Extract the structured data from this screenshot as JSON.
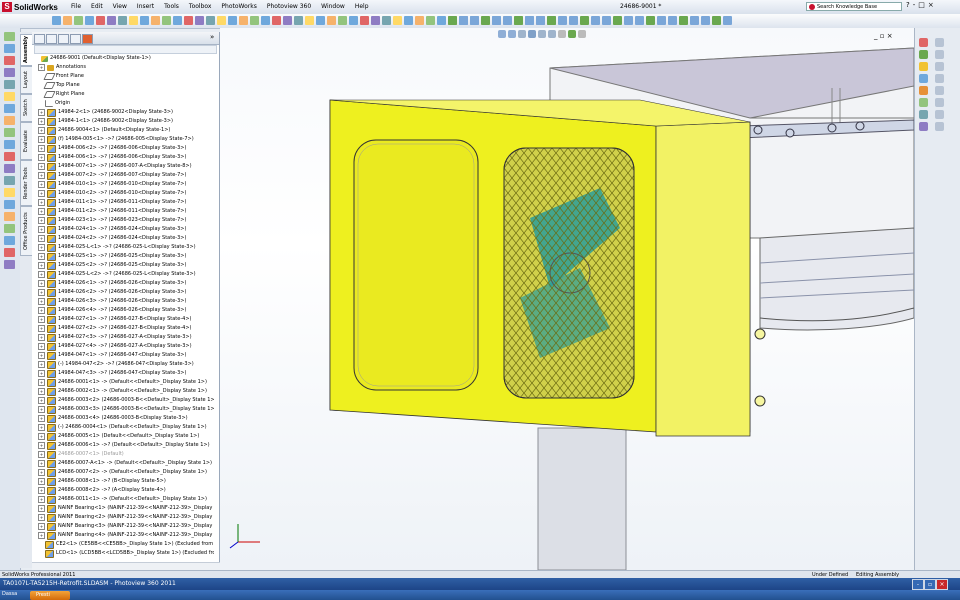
{
  "app": {
    "name": "SolidWorks",
    "document_title": "24686-9001 *"
  },
  "menu": [
    "File",
    "Edit",
    "View",
    "Insert",
    "Tools",
    "Toolbox",
    "PhotoWorks",
    "Photoview 360",
    "Window",
    "Help"
  ],
  "search": {
    "placeholder": "Search Knowledge Base"
  },
  "window_controls": [
    "?",
    "-",
    "□",
    "×"
  ],
  "side_tabs": [
    "Assembly",
    "Layout",
    "Sketch",
    "Evaluate",
    "Render Tools",
    "Office Products"
  ],
  "feature_tree": {
    "root": "24686-9001  (Default<Display State-1>)",
    "items": [
      {
        "label": "Annotations",
        "icon": "annotation-icon",
        "exp": "+"
      },
      {
        "label": "Front Plane",
        "icon": "plane-icon",
        "exp": ""
      },
      {
        "label": "Top Plane",
        "icon": "plane-icon",
        "exp": ""
      },
      {
        "label": "Right Plane",
        "icon": "plane-icon",
        "exp": ""
      },
      {
        "label": "Origin",
        "icon": "origin-icon",
        "exp": ""
      },
      {
        "label": "14984-2<1> (24686-9002<Display State-3>)",
        "icon": "assembly-icon",
        "exp": "+"
      },
      {
        "label": "14984-1<1> (24686-9002<Display State-3>)",
        "icon": "assembly-icon",
        "exp": "+"
      },
      {
        "label": "24686-9004<1> (Default<Display State-1>)",
        "icon": "assembly-icon",
        "exp": "+"
      },
      {
        "label": "(f) 14984-005<1> ->? (24686-005<Display State-7>)",
        "icon": "assembly-icon",
        "exp": "+"
      },
      {
        "label": "14984-006<2> ->? (24686-006<Display State-3>)",
        "icon": "assembly-icon",
        "exp": "+"
      },
      {
        "label": "14984-006<1> ->? (24686-006<Display State-3>)",
        "icon": "assembly-icon",
        "exp": "+"
      },
      {
        "label": "14984-007<1> ->? (24686-007-A<Display State-8>)",
        "icon": "assembly-icon",
        "exp": "+"
      },
      {
        "label": "14984-007<2> ->? (24686-007<Display State-7>)",
        "icon": "assembly-icon",
        "exp": "+"
      },
      {
        "label": "14984-010<1> ->? (24686-010<Display State-7>)",
        "icon": "assembly-icon",
        "exp": "+"
      },
      {
        "label": "14984-010<2> ->? (24686-010<Display State-7>)",
        "icon": "assembly-icon",
        "exp": "+"
      },
      {
        "label": "14984-011<1> ->? (24686-011<Display State-7>)",
        "icon": "assembly-icon",
        "exp": "+"
      },
      {
        "label": "14984-011<2> ->? (24686-011<Display State-7>)",
        "icon": "assembly-icon",
        "exp": "+"
      },
      {
        "label": "14984-023<1> ->? (24686-023<Display State-7>)",
        "icon": "assembly-icon",
        "exp": "+"
      },
      {
        "label": "14984-024<1> ->? (24686-024<Display State-3>)",
        "icon": "assembly-icon",
        "exp": "+"
      },
      {
        "label": "14984-024<2> ->? (24686-024<Display State-3>)",
        "icon": "assembly-icon",
        "exp": "+"
      },
      {
        "label": "14984-025-L<1> ->? (24686-025-L<Display State-3>)",
        "icon": "assembly-icon",
        "exp": "+"
      },
      {
        "label": "14984-025<1> ->? (24686-025<Display State-3>)",
        "icon": "assembly-icon",
        "exp": "+"
      },
      {
        "label": "14984-025<2> ->? (24686-025<Display State-3>)",
        "icon": "assembly-icon",
        "exp": "+"
      },
      {
        "label": "14984-025-L<2> ->? (24686-025-L<Display State-3>)",
        "icon": "assembly-icon",
        "exp": "+"
      },
      {
        "label": "14984-026<1> ->? (24686-026<Display State-3>)",
        "icon": "assembly-icon",
        "exp": "+"
      },
      {
        "label": "14984-026<2> ->? (24686-026<Display State-3>)",
        "icon": "assembly-icon",
        "exp": "+"
      },
      {
        "label": "14984-026<3> ->? (24686-026<Display State-3>)",
        "icon": "assembly-icon",
        "exp": "+"
      },
      {
        "label": "14984-026<4> ->? (24686-026<Display State-3>)",
        "icon": "assembly-icon",
        "exp": "+"
      },
      {
        "label": "14984-027<1> ->? (24686-027-B<Display State-4>)",
        "icon": "assembly-icon",
        "exp": "+"
      },
      {
        "label": "14984-027<2> ->? (24686-027-B<Display State-4>)",
        "icon": "assembly-icon",
        "exp": "+"
      },
      {
        "label": "14984-027<3> ->? (24686-027-A<Display State-3>)",
        "icon": "assembly-icon",
        "exp": "+"
      },
      {
        "label": "14984-027<4> ->? (24686-027-A<Display State-3>)",
        "icon": "assembly-icon",
        "exp": "+"
      },
      {
        "label": "14984-047<1> ->? (24686-047<Display State-3>)",
        "icon": "assembly-icon",
        "exp": "+"
      },
      {
        "label": "(-) 14984-047<2> ->? (24686-047<Display State-3>)",
        "icon": "assembly-icon",
        "exp": "+"
      },
      {
        "label": "14984-047<3> ->? (24686-047<Display State-3>)",
        "icon": "assembly-icon",
        "exp": "+"
      },
      {
        "label": "24686-0001<1> -> (Default<<Default>_Display State 1>)",
        "icon": "assembly-icon",
        "exp": "+"
      },
      {
        "label": "24686-0002<1> -> (Default<<Default>_Display State 1>)",
        "icon": "assembly-icon",
        "exp": "+"
      },
      {
        "label": "24686-0003<2> (24686-0003-B<<Default>_Display State 1>)",
        "icon": "assembly-icon",
        "exp": "+"
      },
      {
        "label": "24686-0003<3> (24686-0003-B<<Default>_Display State 1>)",
        "icon": "assembly-icon",
        "exp": "+"
      },
      {
        "label": "24686-0003<4> (24686-0003-B<Display State-3>)",
        "icon": "assembly-icon",
        "exp": "+"
      },
      {
        "label": "(-) 24686-0004<1> (Default<<Default>_Display State 1>)",
        "icon": "assembly-icon",
        "exp": "+"
      },
      {
        "label": "24686-0005<1> (Default<<Default>_Display State 1>)",
        "icon": "assembly-icon",
        "exp": "+"
      },
      {
        "label": "24686-0006<1> ->? (Default<<Default>_Display State 1>)",
        "icon": "assembly-icon",
        "exp": "+"
      },
      {
        "label": "24686-0007<1> (Default)",
        "icon": "assembly-icon",
        "exp": "+",
        "grey": true
      },
      {
        "label": "24686-0007-A<1> -> (Default<<Default>_Display State 1>)",
        "icon": "assembly-icon",
        "exp": "+"
      },
      {
        "label": "24686-0007<2> -> (Default<<Default>_Display State 1>)",
        "icon": "assembly-icon",
        "exp": "+"
      },
      {
        "label": "24686-0008<1> ->? (B<Display State-5>)",
        "icon": "assembly-icon",
        "exp": "+"
      },
      {
        "label": "24686-0008<2> ->? (A<Display State-4>)",
        "icon": "assembly-icon",
        "exp": "+"
      },
      {
        "label": "24686-0011<1> -> (Default<<Default>_Display State 1>)",
        "icon": "assembly-icon",
        "exp": "+"
      },
      {
        "label": "NAINF Bearing<1> (NAINF-212-39<<NAINF-212-39>_Display State",
        "icon": "assembly-icon",
        "exp": "+"
      },
      {
        "label": "NAINF Bearing<2> (NAINF-212-39<<NAINF-212-39>_Display State",
        "icon": "assembly-icon",
        "exp": "+"
      },
      {
        "label": "NAINF Bearing<3> (NAINF-212-39<<NAINF-212-39>_Display State",
        "icon": "assembly-icon",
        "exp": "+"
      },
      {
        "label": "NAINF Bearing<4> (NAINF-212-39<<NAINF-212-39>_Display State",
        "icon": "assembly-icon",
        "exp": "+"
      },
      {
        "label": "CE2<1> (CE5BB<<CE5BB>_Display State 1>) (Excluded from BOM",
        "icon": "assembly-icon",
        "exp": "",
        "grey": false
      },
      {
        "label": "LCD<1> (LCD5BB<<LCD5BB>_Display State 1>) (Excluded from E",
        "icon": "assembly-icon",
        "exp": "",
        "grey": false
      }
    ]
  },
  "status_bar": {
    "left": "SolidWorks Professional 2011",
    "mid": "Under Defined",
    "right": "Editing Assembly"
  },
  "taskbar": {
    "window": "TA0107L-TA5215H-Retrofit.SLDASM - Photoview 360 2011",
    "start_label": "Dassa",
    "button": "Presti"
  },
  "colors": {
    "housing": "#ecec1e",
    "housing_shade": "#cfd11a",
    "mesh": "#c8c83c",
    "fan": "#2a9d9a",
    "brand_red": "#c8102e"
  }
}
